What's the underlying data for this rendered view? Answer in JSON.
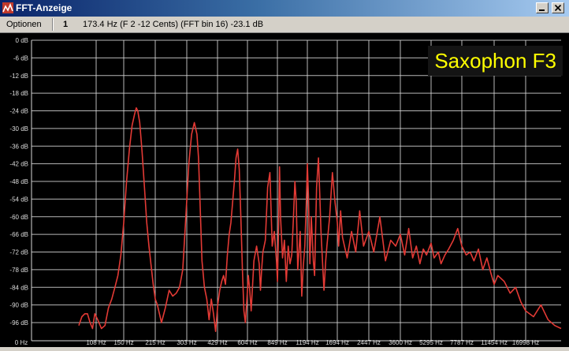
{
  "window": {
    "title": "FFT-Anzeige"
  },
  "menubar": {
    "options_label": "Optionen",
    "channel_label": "1",
    "readout": "173.4 Hz (F 2 -12 Cents) (FFT bin 16) -23.1 dB"
  },
  "overlay": {
    "label": "Saxophon F3",
    "color": "#ffff00"
  },
  "colors": {
    "trace": "#e33a35",
    "grid": "#d8d8d8",
    "background": "#000000",
    "text": "#dddddd"
  },
  "chart_data": {
    "type": "line",
    "y_unit": "dB",
    "ylim": [
      -100,
      0
    ],
    "x_scale": "log",
    "grid": true,
    "y_ticks": [
      "0 dB",
      "-6 dB",
      "-12 dB",
      "-18 dB",
      "-24 dB",
      "-30 dB",
      "-36 dB",
      "-42 dB",
      "-48 dB",
      "-54 dB",
      "-60 dB",
      "-66 dB",
      "-72 dB",
      "-78 dB",
      "-84 dB",
      "-90 dB",
      "-96 dB"
    ],
    "x_ticks": [
      "0 Hz",
      "108 Hz",
      "150 Hz",
      "215 Hz",
      "303 Hz",
      "429 Hz",
      "604 Hz",
      "849 Hz",
      "1194 Hz",
      "1694 Hz",
      "2447 Hz",
      "3600 Hz",
      "5295 Hz",
      "7787 Hz",
      "11454 Hz",
      "16998 Hz"
    ],
    "series": [
      {
        "x": [
          75,
          80,
          85,
          90,
          95,
          100,
          105,
          110,
          115,
          120,
          125,
          130,
          135,
          140,
          145,
          150,
          155,
          160,
          165,
          170,
          173,
          176,
          180,
          185,
          190,
          195,
          200,
          210,
          215,
          220,
          230,
          240,
          250,
          260,
          270,
          280,
          290,
          300,
          310,
          320,
          330,
          340,
          346,
          352,
          360,
          370,
          380,
          390,
          400,
          410,
          420,
          430,
          440,
          450,
          460,
          470,
          480,
          490,
          500,
          510,
          520,
          530,
          540,
          550,
          560,
          570,
          580,
          590,
          600,
          610,
          620,
          630,
          650,
          670,
          690,
          700,
          710,
          720,
          740,
          760,
          780,
          800,
          820,
          840,
          850,
          860,
          870,
          880,
          900,
          920,
          940,
          960,
          980,
          1000,
          1020,
          1036,
          1052,
          1070,
          1100,
          1120,
          1140,
          1160,
          1180,
          1194,
          1210,
          1230,
          1250,
          1280,
          1300,
          1330,
          1360,
          1380,
          1400,
          1420,
          1450,
          1480,
          1500,
          1550,
          1600,
          1650,
          1694,
          1720,
          1760,
          1800,
          1900,
          2000,
          2100,
          2200,
          2300,
          2447,
          2600,
          2800,
          3000,
          3200,
          3400,
          3600,
          3800,
          4000,
          4200,
          4400,
          4600,
          4800,
          5000,
          5295,
          5500,
          5800,
          6000,
          6300,
          6600,
          7000,
          7400,
          7787,
          8200,
          8600,
          9000,
          9500,
          10000,
          10500,
          11000,
          11454,
          12000,
          13000,
          14000,
          15000,
          16000,
          16998,
          18000,
          19000,
          20000,
          21000,
          22000
        ],
        "y": [
          -97,
          -94,
          -93,
          -93,
          -96,
          -98,
          -93,
          -95,
          -98,
          -97,
          -91,
          -88,
          -84,
          -80,
          -73,
          -62,
          -48,
          -37,
          -29,
          -25,
          -23,
          -24,
          -28,
          -38,
          -50,
          -62,
          -70,
          -83,
          -88,
          -90,
          -96,
          -91,
          -85,
          -87,
          -86,
          -84,
          -78,
          -60,
          -42,
          -32,
          -28,
          -32,
          -40,
          -55,
          -75,
          -84,
          -88,
          -95,
          -88,
          -93,
          -99,
          -90,
          -85,
          -82,
          -80,
          -83,
          -73,
          -66,
          -62,
          -55,
          -48,
          -40,
          -37,
          -44,
          -60,
          -78,
          -92,
          -96,
          -88,
          -80,
          -85,
          -92,
          -75,
          -70,
          -76,
          -85,
          -78,
          -72,
          -68,
          -50,
          -45,
          -70,
          -65,
          -75,
          -82,
          -65,
          -43,
          -60,
          -74,
          -68,
          -82,
          -70,
          -76,
          -73,
          -60,
          -48,
          -55,
          -78,
          -65,
          -87,
          -77,
          -70,
          -55,
          -42,
          -53,
          -76,
          -60,
          -75,
          -80,
          -50,
          -40,
          -52,
          -65,
          -73,
          -85,
          -75,
          -70,
          -60,
          -45,
          -55,
          -62,
          -70,
          -58,
          -67,
          -74,
          -65,
          -72,
          -58,
          -70,
          -65,
          -72,
          -60,
          -75,
          -68,
          -70,
          -66,
          -73,
          -64,
          -74,
          -70,
          -76,
          -71,
          -73,
          -69,
          -74,
          -72,
          -76,
          -73,
          -71,
          -68,
          -64,
          -70,
          -73,
          -72,
          -75,
          -71,
          -78,
          -74,
          -79,
          -83,
          -80,
          -82,
          -86,
          -84,
          -89,
          -92,
          -94,
          -90,
          -95,
          -97,
          -98
        ]
      }
    ]
  }
}
